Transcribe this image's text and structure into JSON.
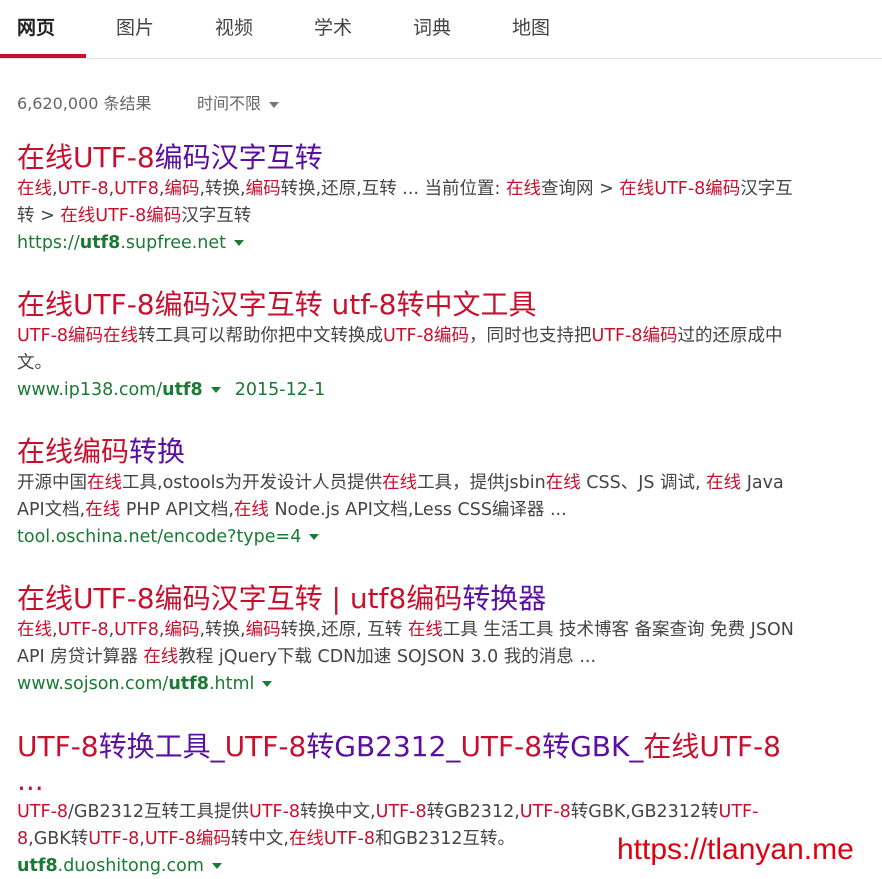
{
  "tabs": [
    "网页",
    "图片",
    "视频",
    "学术",
    "词典",
    "地图"
  ],
  "active_tab": "网页",
  "result_count": "6,620,000 条结果",
  "time_filter": "时间不限",
  "results": [
    {
      "title": [
        [
          "在线",
          "hl"
        ],
        [
          "UTF-8",
          "hl"
        ],
        [
          "编码汉字互转",
          ""
        ]
      ],
      "snippet": [
        [
          "在线",
          "hl"
        ],
        [
          ",",
          ""
        ],
        [
          "UTF-8",
          "hl"
        ],
        [
          ",",
          ""
        ],
        [
          "UTF8",
          "hl"
        ],
        [
          ",",
          ""
        ],
        [
          "编码",
          "hl"
        ],
        [
          ",转换,",
          ""
        ],
        [
          "编码",
          "hl"
        ],
        [
          "转换,还原,互转 ... 当前位置: ",
          ""
        ],
        [
          "在线",
          "hl"
        ],
        [
          "查询网 > ",
          ""
        ],
        [
          "在线UTF-8编码",
          "hl"
        ],
        [
          "汉字互转 > ",
          ""
        ],
        [
          "在线UTF-8编码",
          "hl"
        ],
        [
          "汉字互转",
          ""
        ]
      ],
      "url": [
        [
          "https://",
          ""
        ],
        [
          "utf8",
          "b"
        ],
        [
          ".supfree.net",
          ""
        ]
      ],
      "date": ""
    },
    {
      "title": [
        [
          "在线UTF-8编码汉字互转 ",
          "hl"
        ],
        [
          "utf-8",
          "hl"
        ],
        [
          "转中文工具",
          "hl"
        ]
      ],
      "snippet": [
        [
          "UTF-8编码",
          "hl"
        ],
        [
          "在线",
          "hl"
        ],
        [
          "转工具可以帮助你把中文转换成",
          ""
        ],
        [
          "UTF-8编码",
          "hl"
        ],
        [
          "，同时也支持把",
          ""
        ],
        [
          "UTF-8编码",
          "hl"
        ],
        [
          "过的还原成中文。",
          ""
        ]
      ],
      "url": [
        [
          "www.ip138.com/",
          ""
        ],
        [
          "utf8",
          "b"
        ]
      ],
      "date": "2015-12-1"
    },
    {
      "title": [
        [
          "在线",
          "hl"
        ],
        [
          "编码",
          "hl"
        ],
        [
          "转换",
          ""
        ]
      ],
      "snippet": [
        [
          "开源中国",
          ""
        ],
        [
          "在线",
          "hl"
        ],
        [
          "工具,ostools为开发设计人员提供",
          ""
        ],
        [
          "在线",
          "hl"
        ],
        [
          "工具，提供jsbin",
          ""
        ],
        [
          "在线",
          "hl"
        ],
        [
          " CSS、JS 调试, ",
          ""
        ],
        [
          "在线",
          "hl"
        ],
        [
          " Java API文档,",
          ""
        ],
        [
          "在线",
          "hl"
        ],
        [
          " PHP API文档,",
          ""
        ],
        [
          "在线",
          "hl"
        ],
        [
          " Node.js API文档,Less CSS编译器 ...",
          ""
        ]
      ],
      "url": [
        [
          "tool.oschina.net/encode?type=4",
          ""
        ]
      ],
      "date": ""
    },
    {
      "title": [
        [
          "在线UTF-8编码汉字互转 | ",
          "hl"
        ],
        [
          "utf8编码",
          "hl"
        ],
        [
          "转换器",
          ""
        ]
      ],
      "snippet": [
        [
          "在线",
          "hl"
        ],
        [
          ",",
          ""
        ],
        [
          "UTF-8",
          "hl"
        ],
        [
          ",",
          ""
        ],
        [
          "UTF8",
          "hl"
        ],
        [
          ",",
          ""
        ],
        [
          "编码",
          "hl"
        ],
        [
          ",转换,",
          ""
        ],
        [
          "编码",
          "hl"
        ],
        [
          "转换,还原, 互转 ",
          ""
        ],
        [
          "在线",
          "hl"
        ],
        [
          "工具 生活工具 技术博客 备案查询 免费 JSON API 房贷计算器 ",
          ""
        ],
        [
          "在线",
          "hl"
        ],
        [
          "教程 jQuery下载 CDN加速 SOJSON 3.0 我的消息 ...",
          ""
        ]
      ],
      "url": [
        [
          "www.sojson.com/",
          ""
        ],
        [
          "utf8",
          "b"
        ],
        [
          ".html",
          ""
        ]
      ],
      "date": ""
    },
    {
      "title": [
        [
          "UTF-8",
          "hl"
        ],
        [
          "转换工具_",
          ""
        ],
        [
          "UTF-8",
          "hl"
        ],
        [
          "转GB2312_",
          ""
        ],
        [
          "UTF-8",
          "hl"
        ],
        [
          "转GBK_",
          ""
        ],
        [
          "在线UTF-8 ...",
          "hl"
        ]
      ],
      "snippet": [
        [
          "UTF-8",
          "hl"
        ],
        [
          "/GB2312互转工具提供",
          ""
        ],
        [
          "UTF-8",
          "hl"
        ],
        [
          "转换中文,",
          ""
        ],
        [
          "UTF-8",
          "hl"
        ],
        [
          "转GB2312,",
          ""
        ],
        [
          "UTF-8",
          "hl"
        ],
        [
          "转GBK,GB2312转",
          ""
        ],
        [
          "UTF-8",
          "hl"
        ],
        [
          ",GBK转",
          ""
        ],
        [
          "UTF-8",
          "hl"
        ],
        [
          ",",
          ""
        ],
        [
          "UTF-8编码",
          "hl"
        ],
        [
          "转中文,",
          ""
        ],
        [
          "在线UTF-8",
          "hl"
        ],
        [
          "和GB2312互转。",
          ""
        ]
      ],
      "url": [
        [
          "utf8",
          "b"
        ],
        [
          ".duoshitong.com",
          ""
        ]
      ],
      "date": ""
    }
  ],
  "watermark": "https://tlanyan.me",
  "colors": {
    "accent": "#c8102e",
    "link_visited": "#5b0fa0",
    "url_green": "#1a7a33"
  },
  "icons": {
    "filter_dropdown": "caret-down-icon",
    "url_menu": "caret-down-icon"
  }
}
